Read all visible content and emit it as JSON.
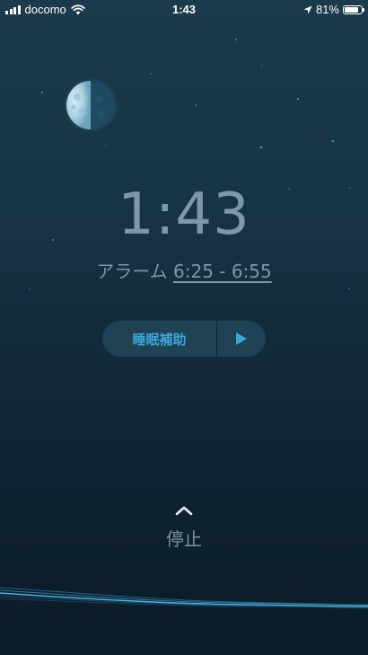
{
  "status_bar": {
    "carrier": "docomo",
    "time": "1:43",
    "battery_percent": "81%",
    "battery_level": 0.81,
    "icons": [
      "signal-icon",
      "wifi-icon",
      "location-icon",
      "battery-icon"
    ]
  },
  "main": {
    "clock_time": "1:43",
    "alarm_label": "アラーム",
    "alarm_range": "6:25 - 6:55"
  },
  "sleep_aid": {
    "label": "睡眠補助",
    "play_icon": "play-icon"
  },
  "stop": {
    "label": "停止",
    "icon": "chevron-up-icon"
  },
  "colors": {
    "accent": "#3ea7d9",
    "clock_text": "#7e97aa",
    "background_top": "#1b3a4b",
    "background_bottom": "#0b1b27"
  }
}
